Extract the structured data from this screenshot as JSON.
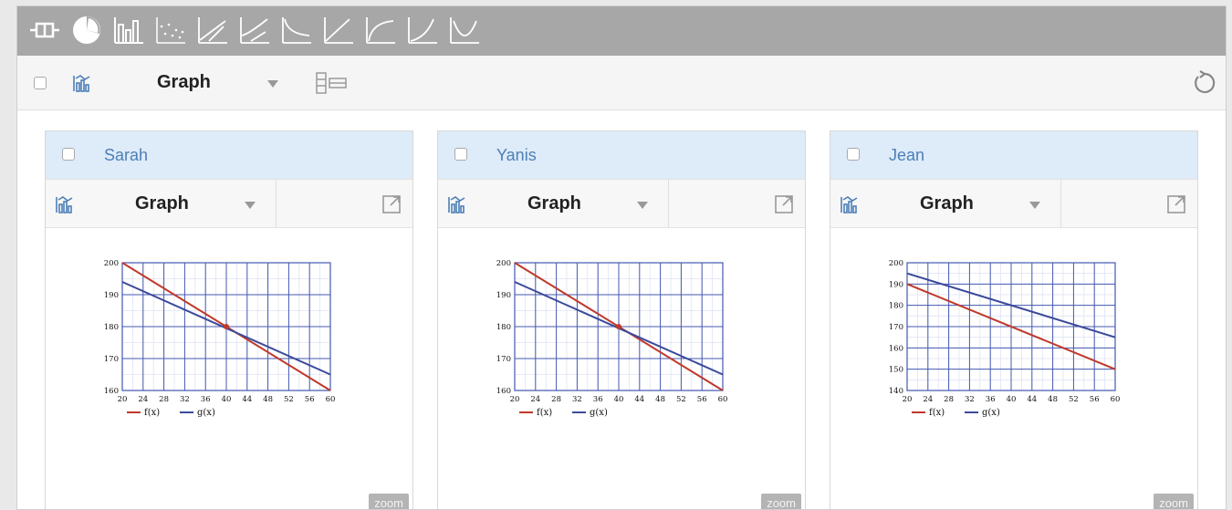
{
  "toolbar": {
    "icons": [
      "box-plot-icon",
      "pie-chart-icon",
      "bar-chart-icon",
      "dot-plot-icon",
      "linear-regression-icon",
      "exponential-regression-icon",
      "reciprocal-regression-icon",
      "linear-function-icon",
      "logarithmic-regression-icon",
      "power-regression-icon",
      "quadratic-regression-icon"
    ]
  },
  "subtoolbar": {
    "view_label": "Graph"
  },
  "panels": [
    {
      "title": "Sarah",
      "view_label": "Graph",
      "zoom_label": "zoom",
      "chart_data": {
        "type": "line",
        "x": [
          20,
          60
        ],
        "series": [
          {
            "name": "f(x)",
            "values": [
              200,
              160
            ],
            "color": "#c0392b"
          },
          {
            "name": "g(x)",
            "values": [
              194,
              165
            ],
            "color": "#3b4a9a"
          }
        ],
        "xlim": [
          20,
          60
        ],
        "ylim": [
          160,
          200
        ],
        "xticks": [
          "20",
          "24",
          "28",
          "32",
          "36",
          "40",
          "44",
          "48",
          "52",
          "56",
          "60"
        ],
        "yticks": [
          "160",
          "170",
          "180",
          "190",
          "200"
        ],
        "intersection": [
          40,
          180
        ]
      }
    },
    {
      "title": "Yanis",
      "view_label": "Graph",
      "zoom_label": "zoom",
      "chart_data": {
        "type": "line",
        "x": [
          20,
          60
        ],
        "series": [
          {
            "name": "f(x)",
            "values": [
              200,
              160
            ],
            "color": "#c0392b"
          },
          {
            "name": "g(x)",
            "values": [
              194,
              165
            ],
            "color": "#3b4a9a"
          }
        ],
        "xlim": [
          20,
          60
        ],
        "ylim": [
          160,
          200
        ],
        "xticks": [
          "20",
          "24",
          "28",
          "32",
          "36",
          "40",
          "44",
          "48",
          "52",
          "56",
          "60"
        ],
        "yticks": [
          "160",
          "170",
          "180",
          "190",
          "200"
        ],
        "intersection": [
          40,
          180
        ]
      }
    },
    {
      "title": "Jean",
      "view_label": "Graph",
      "zoom_label": "zoom",
      "chart_data": {
        "type": "line",
        "x": [
          20,
          60
        ],
        "series": [
          {
            "name": "f(x)",
            "values": [
              190,
              150
            ],
            "color": "#c0392b"
          },
          {
            "name": "g(x)",
            "values": [
              195,
              165
            ],
            "color": "#3b4a9a"
          }
        ],
        "xlim": [
          20,
          60
        ],
        "ylim": [
          140,
          200
        ],
        "xticks": [
          "20",
          "24",
          "28",
          "32",
          "36",
          "40",
          "44",
          "48",
          "52",
          "56",
          "60"
        ],
        "yticks": [
          "140",
          "150",
          "160",
          "170",
          "180",
          "190",
          "200"
        ]
      }
    }
  ]
}
